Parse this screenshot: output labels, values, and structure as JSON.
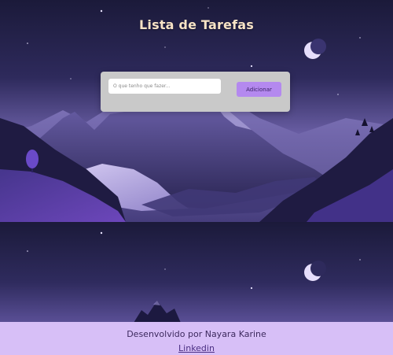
{
  "header": {
    "title": "Lista de Tarefas"
  },
  "todo_form": {
    "input_value": "",
    "input_placeholder": "O que tenho que fazer...",
    "add_label": "Adicionar"
  },
  "footer": {
    "credit": "Desenvolvido por Nayara Karine",
    "link_label": "Linkedin"
  },
  "theme": {
    "sky_top": "#1b1a3a",
    "sky_horizon": "#8b7cc8",
    "mountain_purple": "#5a4d93",
    "grass_violet": "#6a3fc0",
    "card_bg": "#c9c9c9",
    "button_bg": "#b489ef",
    "footer_bg": "#d7bff7",
    "title_color": "#f7e3c6"
  }
}
